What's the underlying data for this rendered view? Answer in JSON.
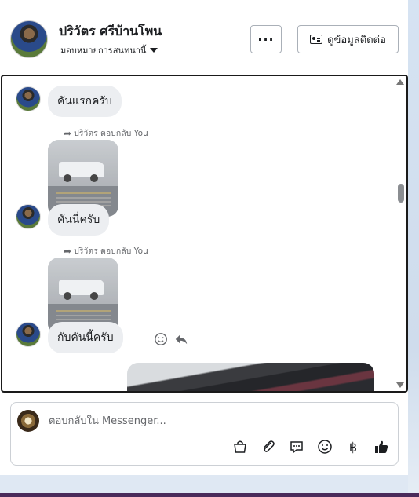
{
  "header": {
    "name": "ปริวัตร ศรีบ้านโพน",
    "assign_label": "มอบหมายการสนทนานี้",
    "more_label": "···",
    "contact_label": "ดูข้อมูลติดต่อ"
  },
  "thread": {
    "messages": [
      {
        "type": "text",
        "text": "คันแรกครับ"
      },
      {
        "type": "reply",
        "reply_label": "ปริวัตร ตอบกลับ You",
        "text": "คันนี่ครับ"
      },
      {
        "type": "reply",
        "reply_label": "ปริวัตร ตอบกลับ You",
        "text": "กับคันนี้ครับ"
      }
    ]
  },
  "composer": {
    "placeholder": "ตอบกลับใน Messenger...",
    "tools": [
      "shopping-bag-icon",
      "paperclip-icon",
      "saved-replies-icon",
      "emoji-icon",
      "baht-icon",
      "thumbs-up-icon"
    ],
    "baht_symbol": "฿"
  },
  "colors": {
    "accent": "#1c1e21",
    "bubble": "#eceef1",
    "muted": "#65676b"
  }
}
